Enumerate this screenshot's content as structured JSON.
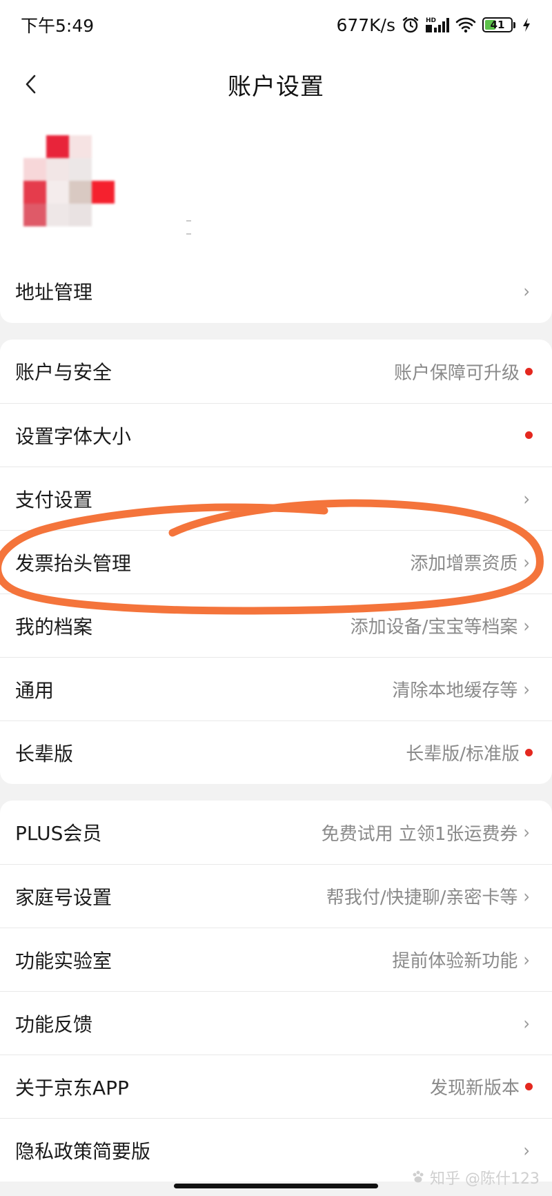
{
  "status_bar": {
    "time": "下午5:49",
    "net_speed": "677K/s",
    "battery_level": "41",
    "battery_fill_percent": 41,
    "icons": [
      "alarm-icon",
      "hd-signal-icon",
      "wifi-icon",
      "battery-icon",
      "charging-icon"
    ],
    "hd_label": "HD"
  },
  "nav": {
    "title": "账户设置",
    "back_icon": "chevron-left-icon"
  },
  "profile": {
    "avatar_colors": [
      "#ffffff",
      "#e8243a",
      "#f6e3e3",
      "#ffffff",
      "#f7d7d9",
      "#f2e6e6",
      "#ece7e7",
      "#ffffff",
      "#e53c4c",
      "#f4ecec",
      "#d9c9c2",
      "#f5212e",
      "#df5a68",
      "#eee7e7",
      "#e9e2e2",
      "#ffffff"
    ]
  },
  "section1": {
    "items": [
      {
        "label": "地址管理",
        "value": "",
        "chevron": true,
        "dot": false
      }
    ]
  },
  "section2": {
    "items": [
      {
        "label": "账户与安全",
        "value": "账户保障可升级",
        "chevron": false,
        "dot": true
      },
      {
        "label": "设置字体大小",
        "value": "",
        "chevron": false,
        "dot": true
      },
      {
        "label": "支付设置",
        "value": "",
        "chevron": true,
        "dot": false
      },
      {
        "label": "发票抬头管理",
        "value": "添加增票资质",
        "chevron": true,
        "dot": false
      },
      {
        "label": "我的档案",
        "value": "添加设备/宝宝等档案",
        "chevron": true,
        "dot": false
      },
      {
        "label": "通用",
        "value": "清除本地缓存等",
        "chevron": true,
        "dot": false
      },
      {
        "label": "长辈版",
        "value": "长辈版/标准版",
        "chevron": false,
        "dot": true
      }
    ]
  },
  "section3": {
    "items": [
      {
        "label": "PLUS会员",
        "value": "免费试用 立领1张运费券",
        "chevron": true,
        "dot": false
      },
      {
        "label": "家庭号设置",
        "value": "帮我付/快捷聊/亲密卡等",
        "chevron": true,
        "dot": false
      },
      {
        "label": "功能实验室",
        "value": "提前体验新功能",
        "chevron": true,
        "dot": false
      },
      {
        "label": "功能反馈",
        "value": "",
        "chevron": true,
        "dot": false
      },
      {
        "label": "关于京东APP",
        "value": "发现新版本",
        "chevron": false,
        "dot": true
      },
      {
        "label": "隐私政策简要版",
        "value": "",
        "chevron": true,
        "dot": false
      }
    ]
  },
  "chevron_glyph": "›",
  "annotation_color": "#f4743b",
  "accent_red": "#e4281f",
  "watermark": {
    "text": "知乎 @陈什123",
    "icon": "paw-icon"
  }
}
